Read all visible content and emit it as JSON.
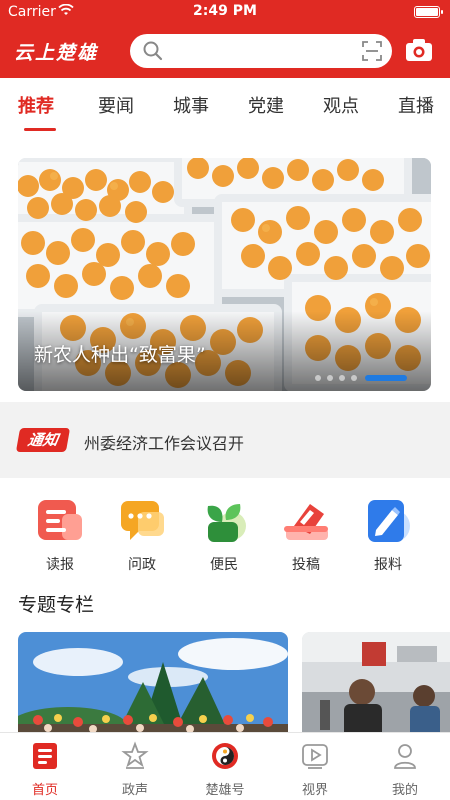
{
  "status": {
    "carrier": "Carrier",
    "time": "2:49 PM"
  },
  "header": {
    "logo": "云上楚雄",
    "search_placeholder": ""
  },
  "tabs": [
    {
      "label": "推荐",
      "active": true
    },
    {
      "label": "要闻"
    },
    {
      "label": "城事"
    },
    {
      "label": "党建"
    },
    {
      "label": "观点"
    },
    {
      "label": "直播"
    }
  ],
  "banner": {
    "caption": "新农人种出“致富果”",
    "slide_count": 5,
    "active_slide": 5
  },
  "notice": {
    "badge": "通知",
    "text": "州委经济工作会议召开"
  },
  "quick_links": [
    {
      "label": "读报",
      "icon": "newspaper-icon"
    },
    {
      "label": "问政",
      "icon": "chat-bubble-icon"
    },
    {
      "label": "便民",
      "icon": "sprout-icon"
    },
    {
      "label": "投稿",
      "icon": "envelope-icon"
    },
    {
      "label": "报料",
      "icon": "edit-note-icon"
    }
  ],
  "section": {
    "title": "专题专栏"
  },
  "bottom_nav": [
    {
      "label": "首页",
      "icon": "home-news-icon",
      "active": true
    },
    {
      "label": "政声",
      "icon": "star-badge-icon"
    },
    {
      "label": "楚雄号",
      "icon": "chuxiong-logo-icon"
    },
    {
      "label": "视界",
      "icon": "video-play-icon"
    },
    {
      "label": "我的",
      "icon": "user-icon"
    }
  ],
  "colors": {
    "brand_red": "#e02a23",
    "indicator_blue": "#1f7ae0"
  }
}
